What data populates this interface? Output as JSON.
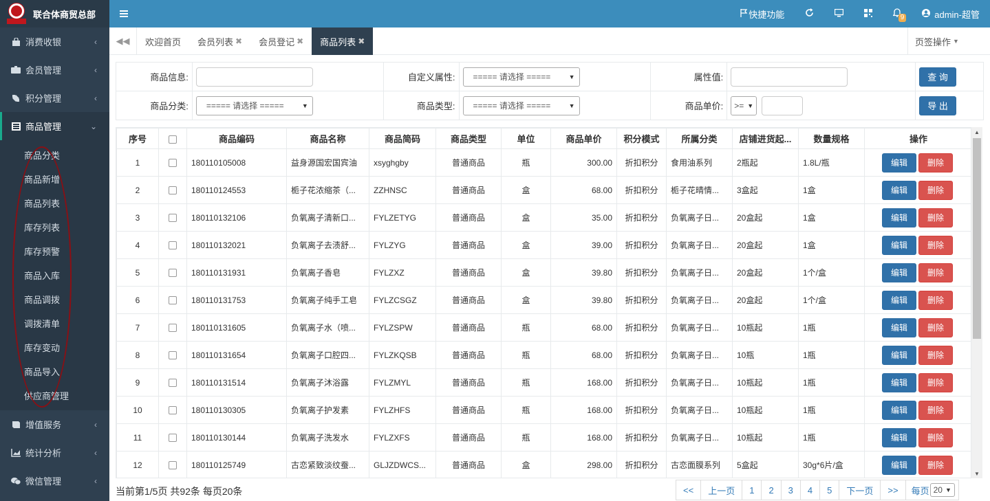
{
  "brand": {
    "name": "联合体商贸总部",
    "logo_text": "联合体"
  },
  "sidebar": {
    "items_top": [
      {
        "label": "消费收银",
        "icon": "bag-icon"
      },
      {
        "label": "会员管理",
        "icon": "members-icon"
      },
      {
        "label": "积分管理",
        "icon": "points-icon"
      },
      {
        "label": "商品管理",
        "icon": "grid-icon"
      }
    ],
    "sub_items": [
      "商品分类",
      "商品新增",
      "商品列表",
      "库存列表",
      "库存预警",
      "商品入库",
      "商品调拨",
      "调拨清单",
      "库存变动",
      "商品导入",
      "供应商管理"
    ],
    "items_bottom": [
      {
        "label": "增值服务",
        "icon": "book-icon"
      },
      {
        "label": "统计分析",
        "icon": "chart-icon"
      },
      {
        "label": "微信管理",
        "icon": "wechat-icon"
      }
    ]
  },
  "topbar": {
    "shortcut": "快捷功能",
    "notifications_count": "9",
    "user": "admin-超管"
  },
  "tabs": [
    {
      "label": "欢迎首页",
      "closable": false
    },
    {
      "label": "会员列表",
      "closable": true
    },
    {
      "label": "会员登记",
      "closable": true
    },
    {
      "label": "商品列表",
      "closable": true,
      "active": true
    }
  ],
  "tab_ops": "页签操作",
  "tab_close": "✖",
  "filter": {
    "product_info_label": "商品信息:",
    "custom_attr_label": "自定义属性:",
    "attr_value_label": "属性值:",
    "category_label": "商品分类:",
    "type_label": "商品类型:",
    "price_label": "商品单价:",
    "select_placeholder": "===== 请选择 =====",
    "price_operator": ">=",
    "query_button": "查 询",
    "export_button": "导 出"
  },
  "table": {
    "columns": [
      "序号",
      "",
      "商品编码",
      "商品名称",
      "商品简码",
      "商品类型",
      "单位",
      "商品单价",
      "积分模式",
      "所属分类",
      "店铺进货起...",
      "数量规格",
      "操作"
    ],
    "edit_label": "编辑",
    "delete_label": "删除",
    "rows": [
      {
        "no": "1",
        "code": "180110105008",
        "name": "益身源国宏国宾油",
        "short": "xsyghgby",
        "type": "普通商品",
        "unit": "瓶",
        "price": "300.00",
        "mode": "折扣积分",
        "category": "食用油系列",
        "min": "2瓶起",
        "spec": "1.8L/瓶"
      },
      {
        "no": "2",
        "code": "180110124553",
        "name": "栀子花浓缩茶（...",
        "short": "ZZHNSC",
        "type": "普通商品",
        "unit": "盒",
        "price": "68.00",
        "mode": "折扣积分",
        "category": "栀子花晴情...",
        "min": "3盒起",
        "spec": "1盒"
      },
      {
        "no": "3",
        "code": "180110132106",
        "name": "负氧离子清新口...",
        "short": "FYLZETYG",
        "type": "普通商品",
        "unit": "盒",
        "price": "35.00",
        "mode": "折扣积分",
        "category": "负氧离子日...",
        "min": "20盒起",
        "spec": "1盒"
      },
      {
        "no": "4",
        "code": "180110132021",
        "name": "负氧离子去渍舒...",
        "short": "FYLZYG",
        "type": "普通商品",
        "unit": "盒",
        "price": "39.00",
        "mode": "折扣积分",
        "category": "负氧离子日...",
        "min": "20盒起",
        "spec": "1盒"
      },
      {
        "no": "5",
        "code": "180110131931",
        "name": "负氧离子香皂",
        "short": "FYLZXZ",
        "type": "普通商品",
        "unit": "盒",
        "price": "39.80",
        "mode": "折扣积分",
        "category": "负氧离子日...",
        "min": "20盒起",
        "spec": "1个/盒"
      },
      {
        "no": "6",
        "code": "180110131753",
        "name": "负氧离子纯手工皂",
        "short": "FYLZCSGZ",
        "type": "普通商品",
        "unit": "盒",
        "price": "39.80",
        "mode": "折扣积分",
        "category": "负氧离子日...",
        "min": "20盒起",
        "spec": "1个/盒"
      },
      {
        "no": "7",
        "code": "180110131605",
        "name": "负氧离子水（喷...",
        "short": "FYLZSPW",
        "type": "普通商品",
        "unit": "瓶",
        "price": "68.00",
        "mode": "折扣积分",
        "category": "负氧离子日...",
        "min": "10瓶起",
        "spec": "1瓶"
      },
      {
        "no": "8",
        "code": "180110131654",
        "name": "负氧离子口腔四...",
        "short": "FYLZKQSB",
        "type": "普通商品",
        "unit": "瓶",
        "price": "68.00",
        "mode": "折扣积分",
        "category": "负氧离子日...",
        "min": "10瓶",
        "spec": "1瓶"
      },
      {
        "no": "9",
        "code": "180110131514",
        "name": "负氧离子沐浴露",
        "short": "FYLZMYL",
        "type": "普通商品",
        "unit": "瓶",
        "price": "168.00",
        "mode": "折扣积分",
        "category": "负氧离子日...",
        "min": "10瓶起",
        "spec": "1瓶"
      },
      {
        "no": "10",
        "code": "180110130305",
        "name": "负氧离子护发素",
        "short": "FYLZHFS",
        "type": "普通商品",
        "unit": "瓶",
        "price": "168.00",
        "mode": "折扣积分",
        "category": "负氧离子日...",
        "min": "10瓶起",
        "spec": "1瓶"
      },
      {
        "no": "11",
        "code": "180110130144",
        "name": "负氧离子洗发水",
        "short": "FYLZXFS",
        "type": "普通商品",
        "unit": "瓶",
        "price": "168.00",
        "mode": "折扣积分",
        "category": "负氧离子日...",
        "min": "10瓶起",
        "spec": "1瓶"
      },
      {
        "no": "12",
        "code": "180110125749",
        "name": "古恋紧致淡纹蚕...",
        "short": "GLJZDWCS...",
        "type": "普通商品",
        "unit": "盒",
        "price": "298.00",
        "mode": "折扣积分",
        "category": "古恋面膜系列",
        "min": "5盒起",
        "spec": "30g*6片/盒"
      }
    ]
  },
  "footer": {
    "info": "当前第1/5页 共92条 每页20条"
  },
  "pager": {
    "first": "<<",
    "prev": "上一页",
    "pages": [
      "1",
      "2",
      "3",
      "4",
      "5"
    ],
    "next": "下一页",
    "last": ">>",
    "size_label": "每页",
    "size_value": "20"
  }
}
